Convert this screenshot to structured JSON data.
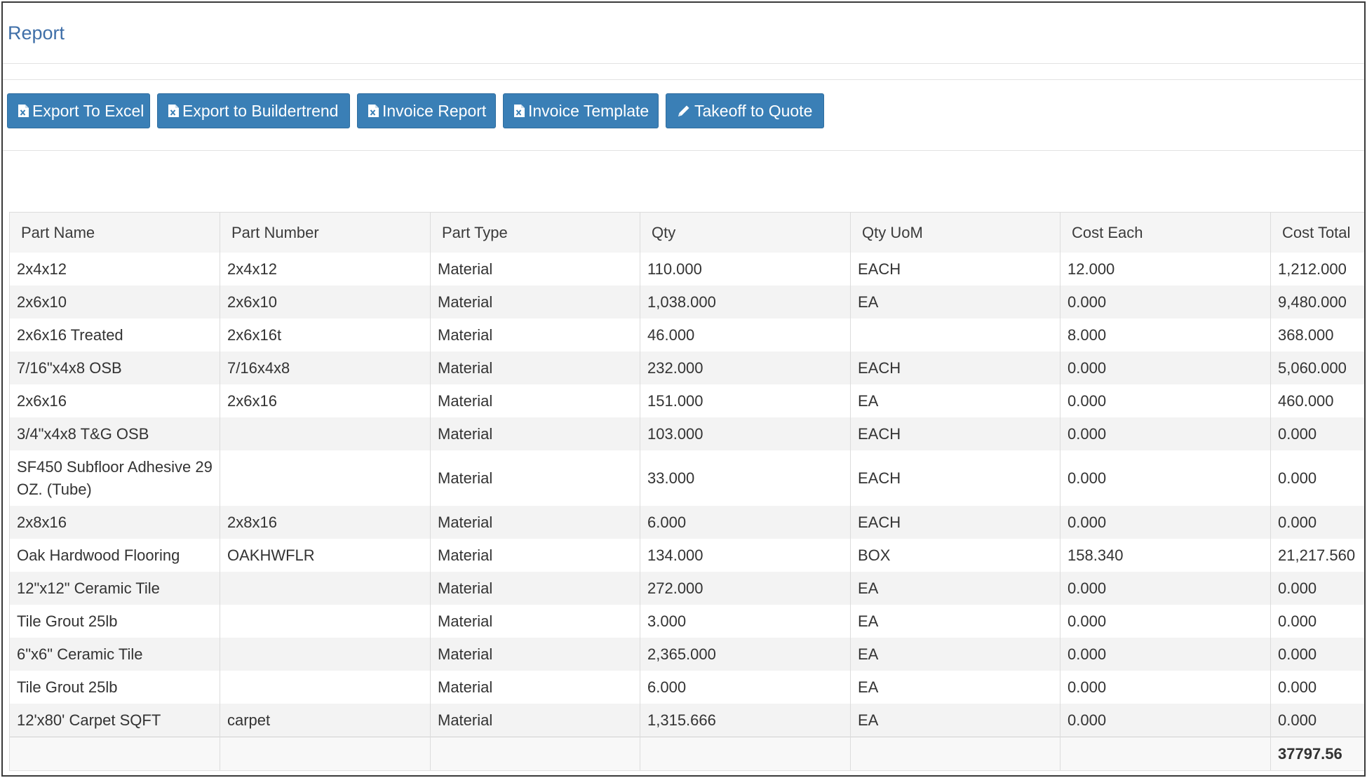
{
  "page": {
    "title": "Report"
  },
  "toolbar": {
    "buttons": [
      {
        "label": "Export To Excel",
        "icon": "excel-file-icon"
      },
      {
        "label": "Export to Buildertrend",
        "icon": "excel-file-icon"
      },
      {
        "label": "Invoice Report",
        "icon": "excel-file-icon"
      },
      {
        "label": "Invoice Template",
        "icon": "excel-file-icon"
      },
      {
        "label": "Takeoff to Quote",
        "icon": "pencil-icon"
      }
    ]
  },
  "table": {
    "columns": [
      "Part Name",
      "Part Number",
      "Part Type",
      "Qty",
      "Qty UoM",
      "Cost Each",
      "Cost Total"
    ],
    "rows": [
      [
        "2x4x12",
        "2x4x12",
        "Material",
        "110.000",
        "EACH",
        "12.000",
        "1,212.000"
      ],
      [
        "2x6x10",
        "2x6x10",
        "Material",
        "1,038.000",
        "EA",
        "0.000",
        "9,480.000"
      ],
      [
        "2x6x16 Treated",
        "2x6x16t",
        "Material",
        "46.000",
        "",
        "8.000",
        "368.000"
      ],
      [
        "7/16\"x4x8 OSB",
        "7/16x4x8",
        "Material",
        "232.000",
        "EACH",
        "0.000",
        "5,060.000"
      ],
      [
        "2x6x16",
        "2x6x16",
        "Material",
        "151.000",
        "EA",
        "0.000",
        "460.000"
      ],
      [
        "3/4\"x4x8 T&G OSB",
        "",
        "Material",
        "103.000",
        "EACH",
        "0.000",
        "0.000"
      ],
      [
        "SF450 Subfloor Adhesive 29 OZ. (Tube)",
        "",
        "Material",
        "33.000",
        "EACH",
        "0.000",
        "0.000"
      ],
      [
        "2x8x16",
        "2x8x16",
        "Material",
        "6.000",
        "EACH",
        "0.000",
        "0.000"
      ],
      [
        "Oak Hardwood Flooring",
        "OAKHWFLR",
        "Material",
        "134.000",
        "BOX",
        "158.340",
        "21,217.560"
      ],
      [
        "12\"x12\" Ceramic Tile",
        "",
        "Material",
        "272.000",
        "EA",
        "0.000",
        "0.000"
      ],
      [
        "Tile Grout 25lb",
        "",
        "Material",
        "3.000",
        "EA",
        "0.000",
        "0.000"
      ],
      [
        "6\"x6\" Ceramic Tile",
        "",
        "Material",
        "2,365.000",
        "EA",
        "0.000",
        "0.000"
      ],
      [
        "Tile Grout 25lb",
        "",
        "Material",
        "6.000",
        "EA",
        "0.000",
        "0.000"
      ],
      [
        "12'x80' Carpet SQFT",
        "carpet",
        "Material",
        "1,315.666",
        "EA",
        "0.000",
        "0.000"
      ]
    ],
    "footer_total": "37797.56"
  },
  "colors": {
    "accent": "#3a7fb6",
    "title": "#3f6fa8"
  }
}
